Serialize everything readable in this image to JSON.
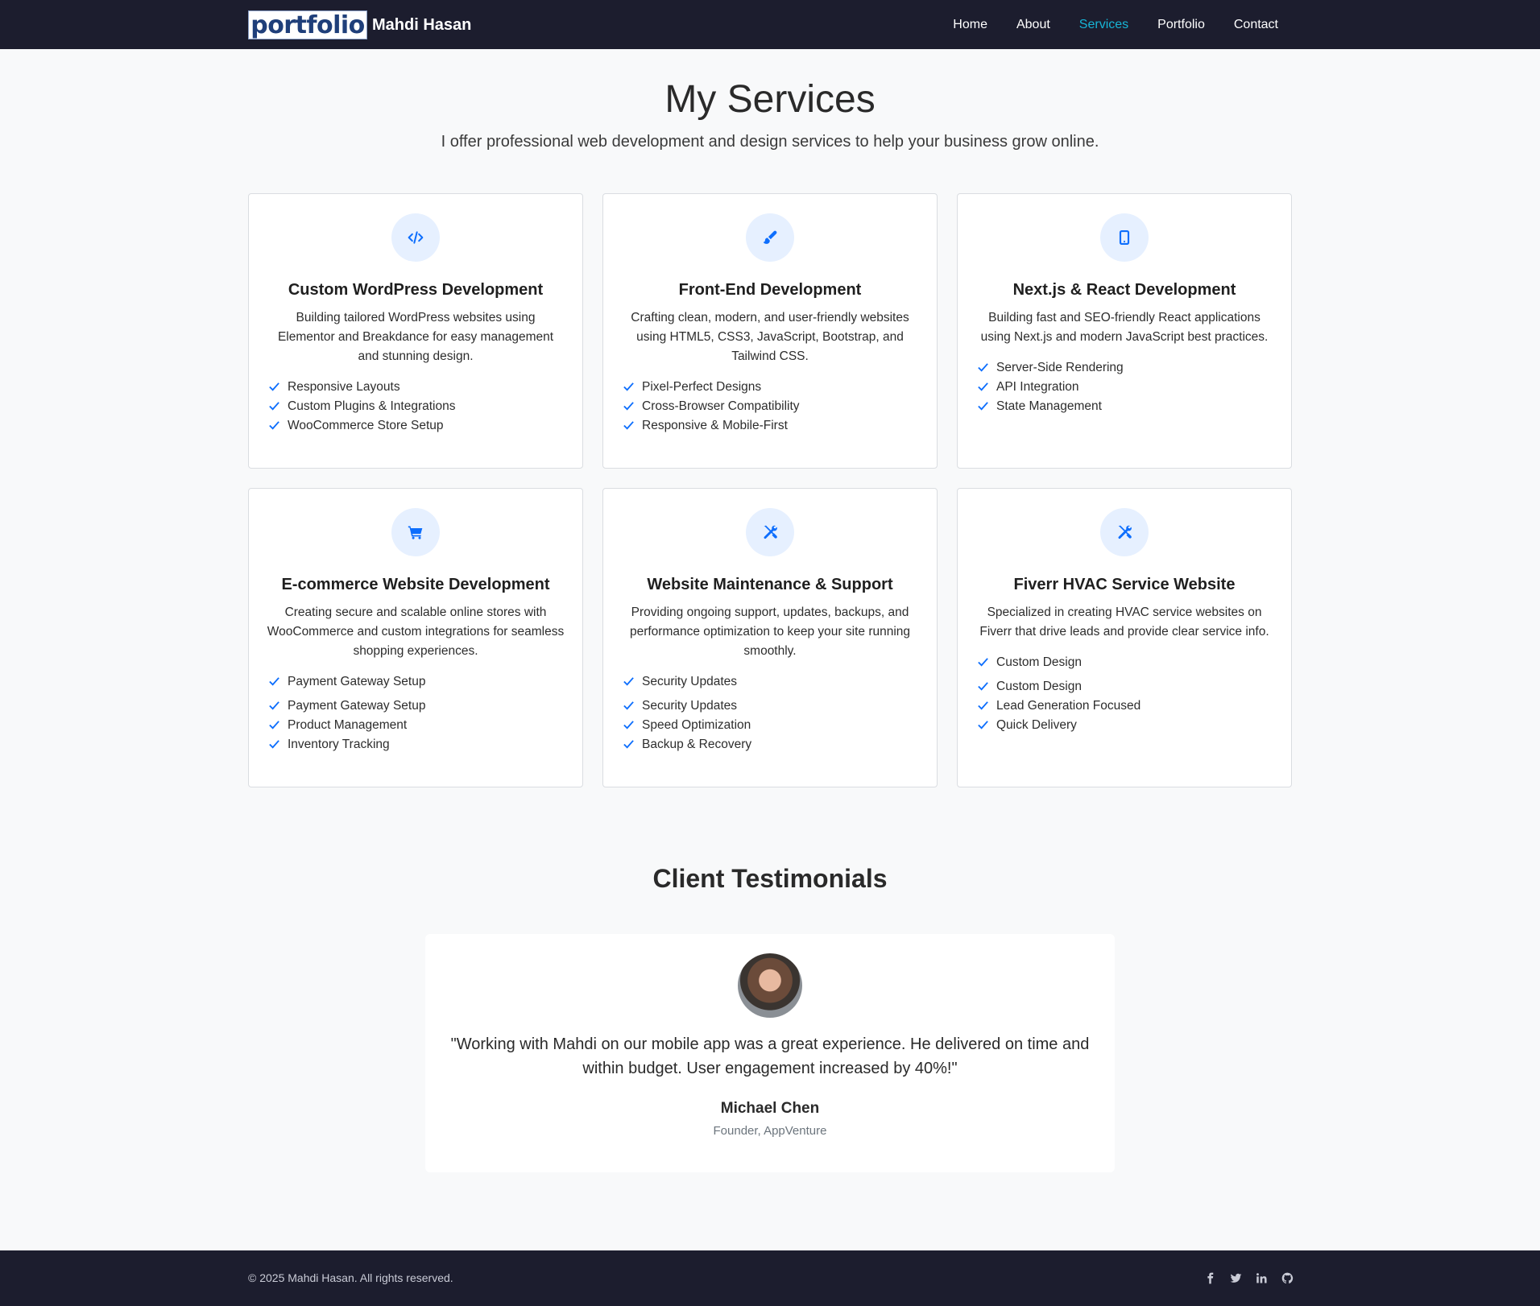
{
  "nav": {
    "logo_text": "portfolio",
    "brand_name": "Mahdi Hasan",
    "links": [
      "Home",
      "About",
      "Services",
      "Portfolio",
      "Contact"
    ],
    "active": "Services",
    "active_color": "#17b5d6"
  },
  "header": {
    "title": "My Services",
    "subtitle": "I offer professional web development and design services to help your business grow online."
  },
  "services": [
    {
      "icon": "code-icon",
      "title": "Custom WordPress Development",
      "description": "Building tailored WordPress websites using Elementor and Breakdance for easy management and stunning design.",
      "features": [
        "Responsive Layouts",
        "Custom Plugins & Integrations",
        "WooCommerce Store Setup"
      ]
    },
    {
      "icon": "paint-brush-icon",
      "title": "Front-End Development",
      "description": "Crafting clean, modern, and user-friendly websites using HTML5, CSS3, JavaScript, Bootstrap, and Tailwind CSS.",
      "features": [
        "Pixel-Perfect Designs",
        "Cross-Browser Compatibility",
        "Responsive & Mobile-First"
      ]
    },
    {
      "icon": "mobile-icon",
      "title": "Next.js & React Development",
      "description": "Building fast and SEO-friendly React applications using Next.js and modern JavaScript best practices.",
      "features": [
        "Server-Side Rendering",
        "API Integration",
        "State Management"
      ]
    },
    {
      "icon": "cart-icon",
      "title": "E-commerce Website Development",
      "description": "Creating secure and scalable online stores with WooCommerce and custom integrations for seamless shopping experiences.",
      "features": [
        "Payment Gateway Setup",
        "Product Management",
        "Inventory Tracking"
      ]
    },
    {
      "icon": "tools-icon",
      "title": "Website Maintenance & Support",
      "description": "Providing ongoing support, updates, backups, and performance optimization to keep your site running smoothly.",
      "features": [
        "Security Updates",
        "Speed Optimization",
        "Backup & Recovery"
      ]
    },
    {
      "icon": "tools-icon",
      "title": "Fiverr HVAC Service Website",
      "description": "Specialized in creating HVAC service websites on Fiverr that drive leads and provide clear service info.",
      "features": [
        "Custom Design",
        "Lead Generation Focused",
        "Quick Delivery"
      ]
    }
  ],
  "testimonials": {
    "title": "Client Testimonials",
    "quote": "\"Working with Mahdi on our mobile app was a great experience. He delivered on time and within budget. User engagement increased by 40%!\"",
    "name": "Michael Chen",
    "role": "Founder, AppVenture"
  },
  "footer": {
    "copyright": "© 2025 Mahdi Hasan. All rights reserved.",
    "social_icons": [
      "facebook-icon",
      "twitter-icon",
      "linkedin-icon",
      "github-icon"
    ]
  },
  "colors": {
    "accent": "#0d6efd",
    "icon_bg": "#e6f0ff",
    "nav_bg": "#1c1d2e"
  }
}
